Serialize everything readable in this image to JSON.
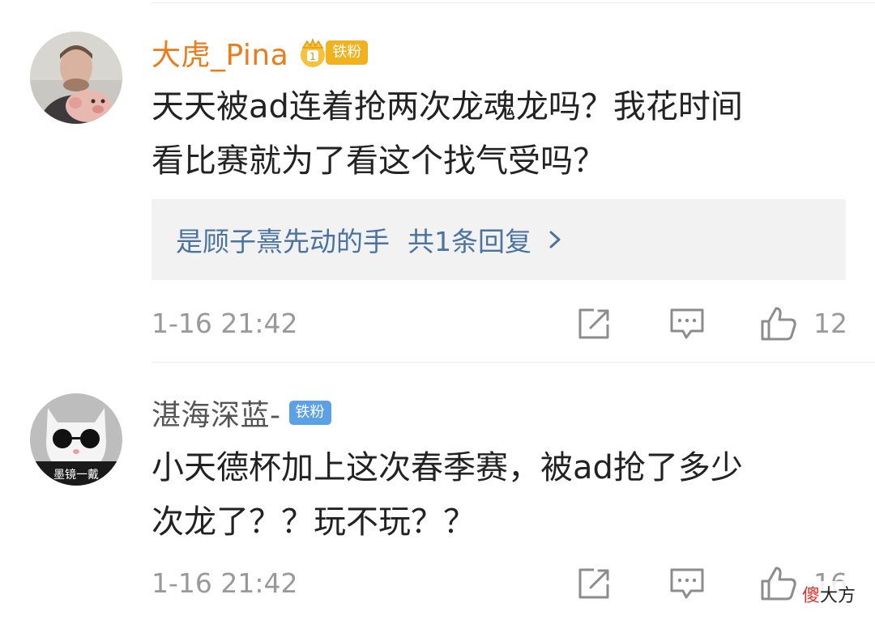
{
  "comments": [
    {
      "avatar_icon": "user-avatar-man-holding-pig-plush",
      "username": "大虎_Pina",
      "username_color": "#eb7c1b",
      "badge_icon": "crown-fan-level-icon",
      "badge": "铁粉",
      "text_line1": "天天被ad连着抢两次龙魂龙吗？我花时间",
      "text_line2": "看比赛就为了看这个找气受吗？",
      "reply": {
        "text": "是顾子熹先动的手",
        "count": "共1条回复",
        "chevron_icon": "chevron-right-icon"
      },
      "time": "1-16 21:42",
      "share_icon": "share-icon",
      "comment_icon": "comment-icon",
      "like_icon": "like-icon",
      "likes": "12"
    },
    {
      "avatar_icon": "user-avatar-cat-sunglasses",
      "avatar_caption": "墨镜一戴",
      "username": "湛海深蓝-",
      "username_color": "#555555",
      "badge": "铁粉",
      "text_line1": "小天德杯加上这次春季赛，被ad抢了多少",
      "text_line2": "次龙了？？玩不玩？？",
      "time": "1-16 21:42",
      "share_icon": "share-icon",
      "comment_icon": "comment-icon",
      "like_icon": "like-icon",
      "likes": "16"
    }
  ],
  "watermark": {
    "red_part": "傻",
    "black_part": "大方"
  }
}
